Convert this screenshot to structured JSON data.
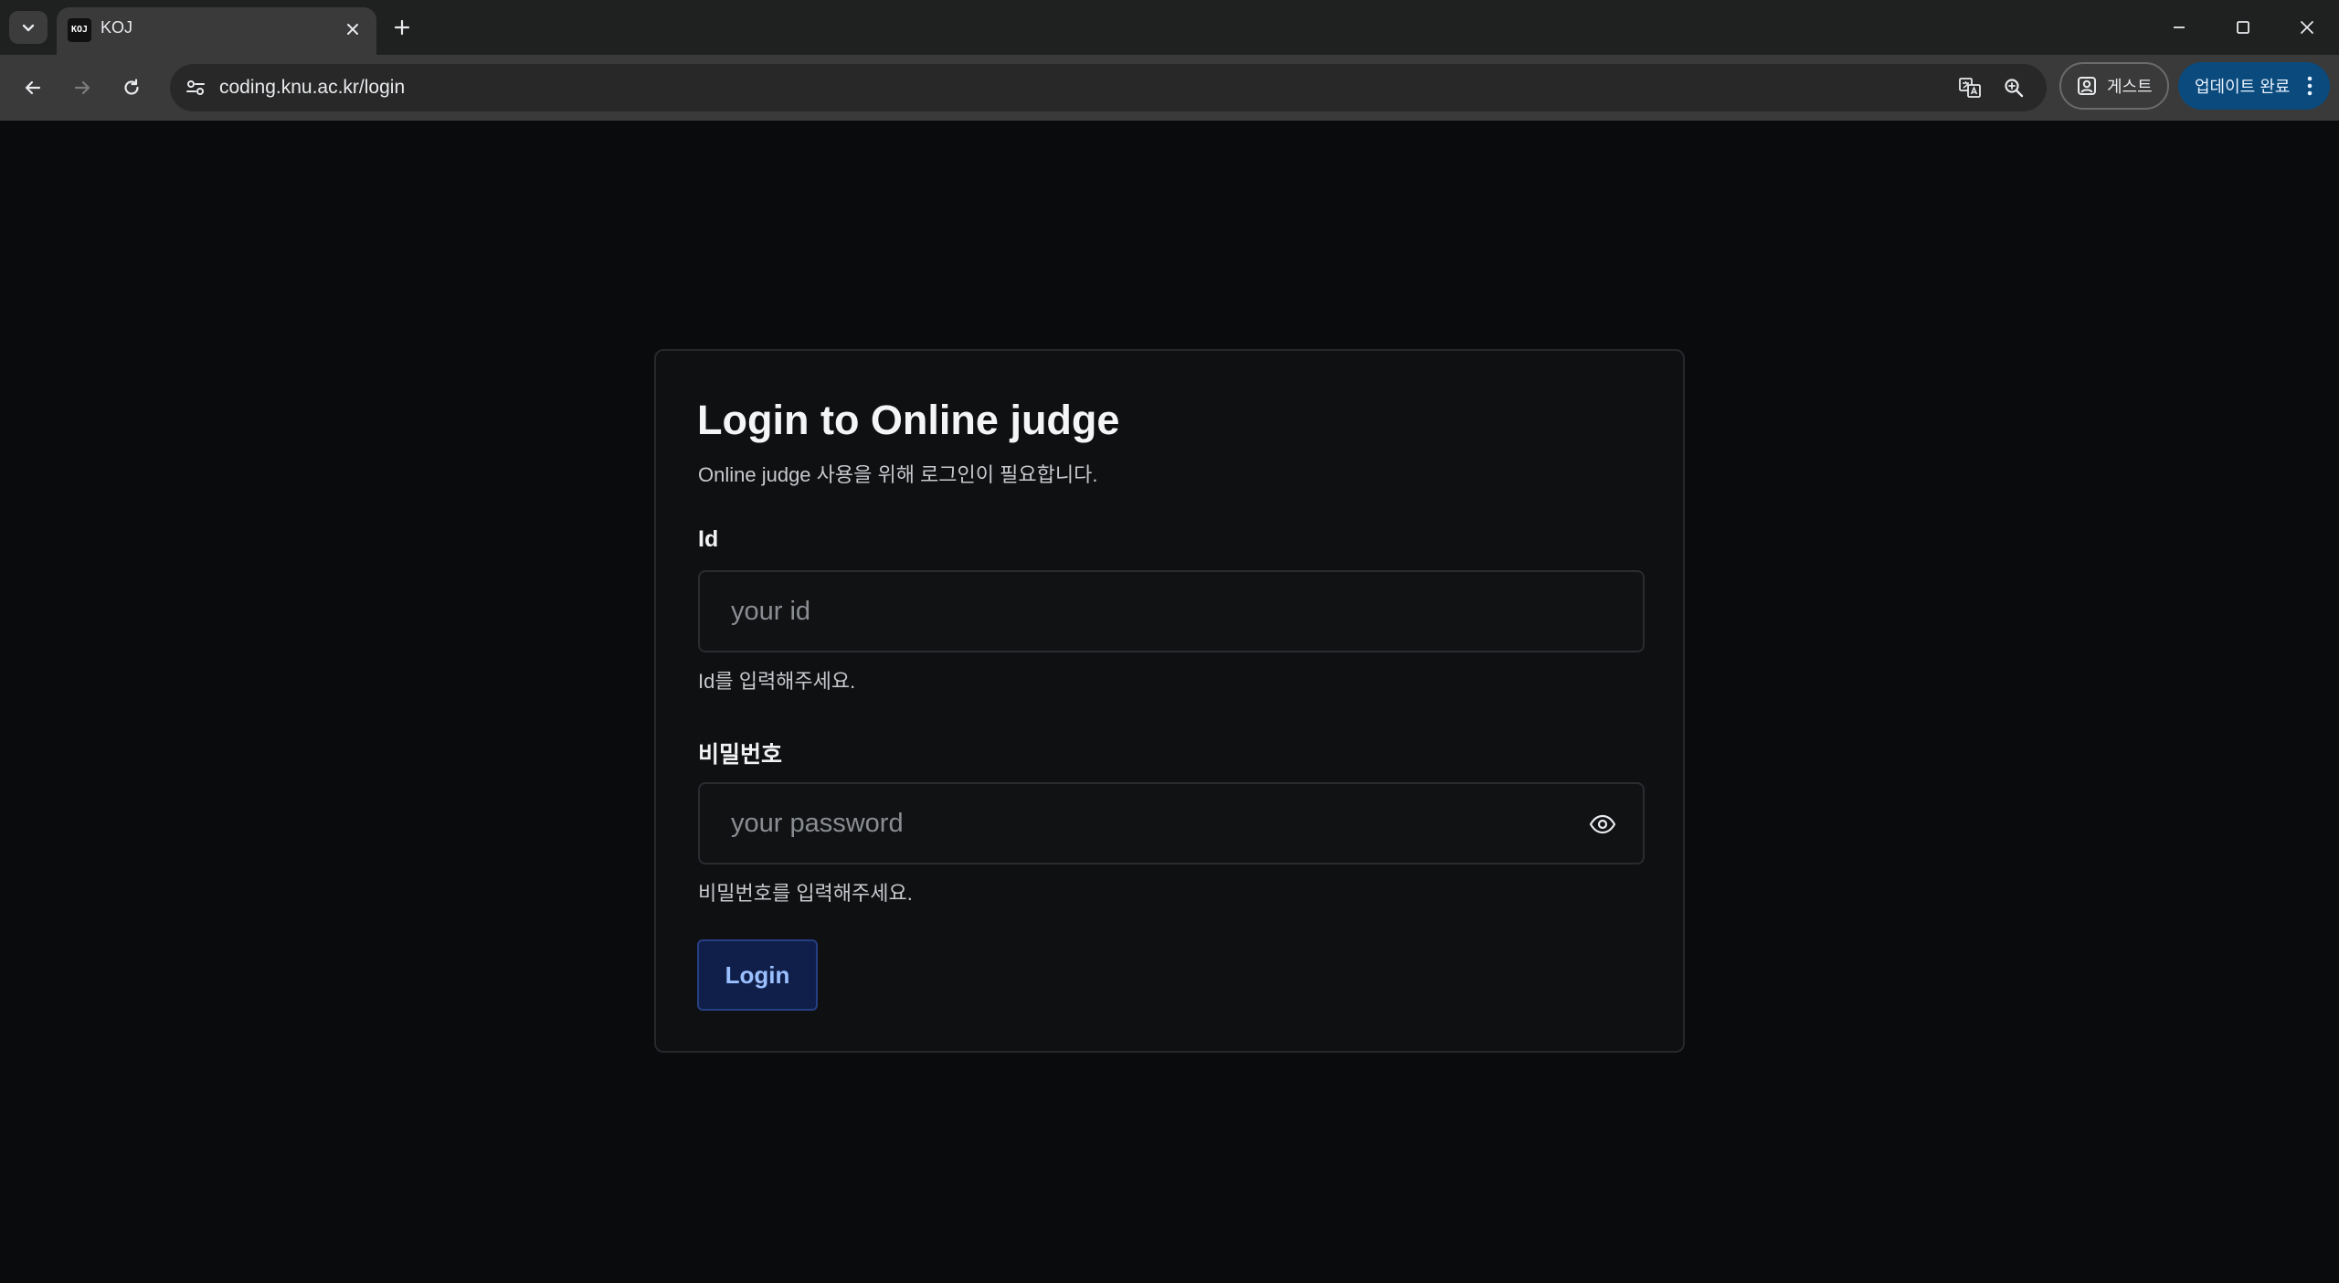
{
  "browser": {
    "tab": {
      "favicon_text": "KOJ",
      "title": "KOJ"
    },
    "url": "coding.knu.ac.kr/login",
    "profile_chip_label": "게스트",
    "update_chip_label": "업데이트 완료",
    "icons": {
      "tab_search": "chevron-down-icon",
      "tab_close": "close-icon",
      "new_tab": "plus-icon",
      "minimize": "minimize-icon",
      "maximize": "maximize-icon",
      "close_window": "close-icon",
      "back": "arrow-left-icon",
      "forward": "arrow-right-icon",
      "reload": "reload-icon",
      "site_info": "tune-icon",
      "translate": "translate-icon",
      "zoom": "zoom-icon",
      "profile": "profile-icon",
      "menu": "kebab-menu-icon"
    }
  },
  "login": {
    "title": "Login to Online judge",
    "subtitle": "Online judge 사용을 위해 로그인이 필요합니다.",
    "id_field": {
      "label": "Id",
      "placeholder": "your id",
      "value": "",
      "helper": "Id를 입력해주세요."
    },
    "password_field": {
      "label": "비밀번호",
      "placeholder": "your password",
      "value": "",
      "helper": "비밀번호를 입력해주세요.",
      "toggle_icon": "eye-icon"
    },
    "submit_label": "Login"
  },
  "colors": {
    "page_background": "#0a0b0d",
    "card_background": "#0f1012",
    "button_background": "#101f4a",
    "button_text": "#9bc0ff",
    "update_chip": "#0b4a7d"
  }
}
